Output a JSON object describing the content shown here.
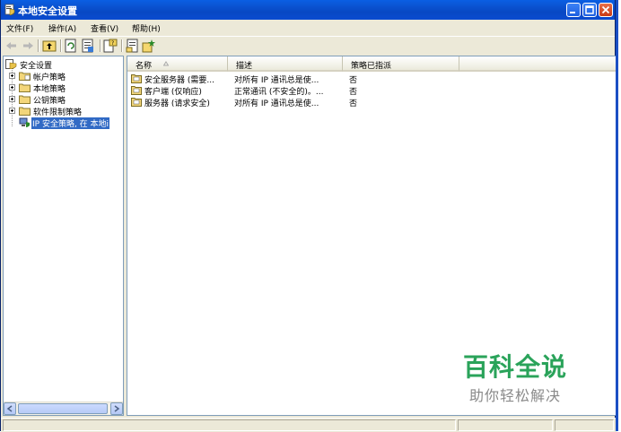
{
  "window": {
    "title": "本地安全设置"
  },
  "menu": [
    {
      "label": "文件(F)"
    },
    {
      "label": "操作(A)"
    },
    {
      "label": "查看(V)"
    },
    {
      "label": "帮助(H)"
    }
  ],
  "toolbar": {
    "icons": [
      "back-arrow-icon",
      "forward-arrow-icon",
      "up-folder-icon",
      "properties-icon",
      "refresh-icon",
      "export-list-icon",
      "help-icon",
      "manage-filters-icon",
      "add-policy-icon"
    ]
  },
  "tree": {
    "root": "安全设置",
    "items": [
      {
        "label": "帐户策略"
      },
      {
        "label": "本地策略"
      },
      {
        "label": "公钥策略"
      },
      {
        "label": "软件限制策略"
      },
      {
        "label": "IP 安全策略, 在 本地i"
      }
    ]
  },
  "list": {
    "columns": [
      "名称",
      "描述",
      "策略已指派"
    ],
    "rows": [
      {
        "name": "安全服务器 (需要...",
        "description": "对所有 IP 通讯总是使...",
        "assigned": "否"
      },
      {
        "name": "客户端 (仅响应)",
        "description": "正常通讯 (不安全的)。...",
        "assigned": "否"
      },
      {
        "name": "服务器 (请求安全)",
        "description": "对所有 IP 通讯总是使...",
        "assigned": "否"
      }
    ]
  },
  "watermark": {
    "title": "百科全说",
    "subtitle": "助你轻松解决"
  },
  "colors": {
    "titlebar": "#0a4bd0",
    "selection": "#316ac5",
    "watermark": "#2aa35a"
  }
}
